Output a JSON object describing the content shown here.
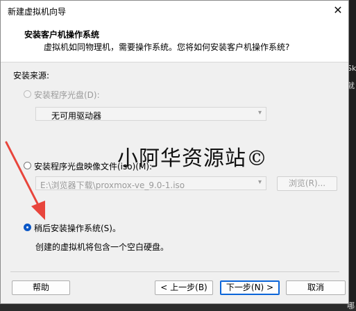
{
  "window": {
    "title": "新建虚拟机向导",
    "close_glyph": "✕"
  },
  "header": {
    "title": "安装客户机操作系统",
    "subtitle": "虚拟机如同物理机，需要操作系统。您将如何安装客户机操作系统?"
  },
  "source": {
    "label": "安装来源:",
    "disc_option": {
      "label": "安装程序光盘(D):",
      "enabled": false
    },
    "disc_select": {
      "value": "无可用驱动器"
    },
    "iso_option": {
      "label": "安装程序光盘映像文件(iso)(M):",
      "enabled": true
    },
    "iso_select": {
      "value": "E:\\浏览器下载\\proxmox-ve_9.0-1.iso"
    },
    "browse_button": {
      "label": "浏览(R)...",
      "enabled": false
    },
    "later_option": {
      "label": "稍后安装操作系统(S)。",
      "selected": true
    },
    "later_description": "创建的虚拟机将包含一个空白硬盘。"
  },
  "footer": {
    "help_label": "帮助",
    "back_label": "< 上一步(B)",
    "next_label": "下一步(N) >",
    "cancel_label": "取消"
  },
  "overlay": {
    "watermark_text": "小阿华资源站©"
  },
  "background": {
    "side_chars": [
      "Sk",
      "就",
      "哪"
    ]
  },
  "colors": {
    "accent": "#0b57c6",
    "arrow": "#e8453c"
  }
}
